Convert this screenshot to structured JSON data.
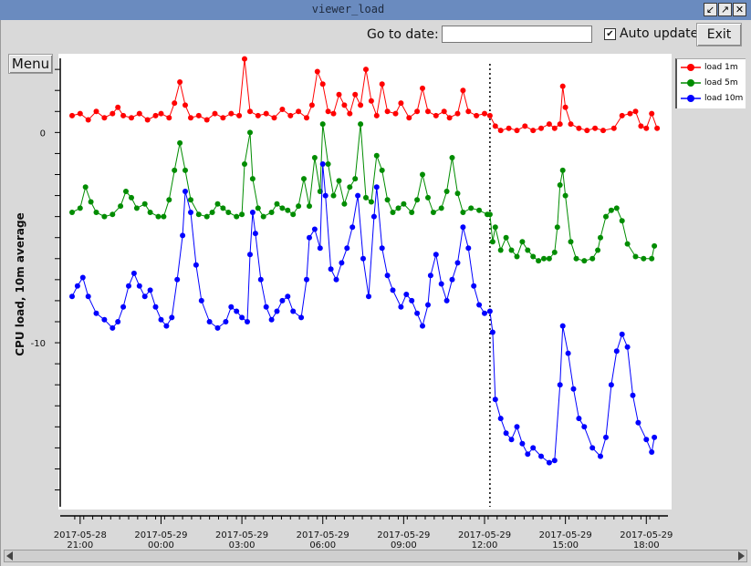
{
  "window": {
    "title": "viewer_load",
    "buttons": [
      "↙",
      "↗",
      "✕"
    ]
  },
  "toolbar": {
    "goto_label": "Go to date:",
    "goto_value": "",
    "auto_update_label": "Auto update",
    "auto_update_checked": true,
    "exit_label": "Exit",
    "menu_label": "Menu"
  },
  "colors": {
    "load_1m": "#ff0000",
    "load_5m": "#008c00",
    "load_10m": "#0000ff"
  },
  "chart_data": {
    "type": "line",
    "ylabel": "CPU load, 10m average",
    "y_ticks": [
      0,
      -10
    ],
    "ylim": [
      -17.8,
      3.7
    ],
    "x_ticks": [
      {
        "t": 21,
        "date": "2017-05-28",
        "time": "21:00"
      },
      {
        "t": 24,
        "date": "2017-05-29",
        "time": "00:00"
      },
      {
        "t": 27,
        "date": "2017-05-29",
        "time": "03:00"
      },
      {
        "t": 30,
        "date": "2017-05-29",
        "time": "06:00"
      },
      {
        "t": 33,
        "date": "2017-05-29",
        "time": "09:00"
      },
      {
        "t": 36,
        "date": "2017-05-29",
        "time": "12:00"
      },
      {
        "t": 39,
        "date": "2017-05-29",
        "time": "15:00"
      },
      {
        "t": 42,
        "date": "2017-05-29",
        "time": "18:00"
      }
    ],
    "xlim": [
      20.6,
      42.6
    ],
    "marker_line_t": 36.2,
    "legend_placement": "outside-right",
    "series": [
      {
        "name": "load 1m",
        "points": [
          [
            20.7,
            0.8
          ],
          [
            21.0,
            0.9
          ],
          [
            21.3,
            0.6
          ],
          [
            21.6,
            1.0
          ],
          [
            21.9,
            0.7
          ],
          [
            22.2,
            0.9
          ],
          [
            22.4,
            1.2
          ],
          [
            22.6,
            0.8
          ],
          [
            22.9,
            0.7
          ],
          [
            23.2,
            0.9
          ],
          [
            23.5,
            0.6
          ],
          [
            23.8,
            0.8
          ],
          [
            24.0,
            0.9
          ],
          [
            24.3,
            0.7
          ],
          [
            24.5,
            1.4
          ],
          [
            24.7,
            2.4
          ],
          [
            24.9,
            1.3
          ],
          [
            25.1,
            0.7
          ],
          [
            25.4,
            0.8
          ],
          [
            25.7,
            0.6
          ],
          [
            26.0,
            0.9
          ],
          [
            26.3,
            0.7
          ],
          [
            26.6,
            0.9
          ],
          [
            26.9,
            0.8
          ],
          [
            27.1,
            3.5
          ],
          [
            27.3,
            1.0
          ],
          [
            27.6,
            0.8
          ],
          [
            27.9,
            0.9
          ],
          [
            28.2,
            0.7
          ],
          [
            28.5,
            1.1
          ],
          [
            28.8,
            0.8
          ],
          [
            29.1,
            1.0
          ],
          [
            29.4,
            0.7
          ],
          [
            29.6,
            1.3
          ],
          [
            29.8,
            2.9
          ],
          [
            30.0,
            2.3
          ],
          [
            30.2,
            1.0
          ],
          [
            30.4,
            0.9
          ],
          [
            30.6,
            1.8
          ],
          [
            30.8,
            1.3
          ],
          [
            31.0,
            0.9
          ],
          [
            31.2,
            1.8
          ],
          [
            31.4,
            1.3
          ],
          [
            31.6,
            3.0
          ],
          [
            31.8,
            1.5
          ],
          [
            32.0,
            0.8
          ],
          [
            32.2,
            2.3
          ],
          [
            32.4,
            1.0
          ],
          [
            32.7,
            0.9
          ],
          [
            32.9,
            1.4
          ],
          [
            33.2,
            0.7
          ],
          [
            33.5,
            1.0
          ],
          [
            33.7,
            2.1
          ],
          [
            33.9,
            1.0
          ],
          [
            34.2,
            0.8
          ],
          [
            34.5,
            1.0
          ],
          [
            34.7,
            0.7
          ],
          [
            35.0,
            0.9
          ],
          [
            35.2,
            2.0
          ],
          [
            35.4,
            1.0
          ],
          [
            35.7,
            0.8
          ],
          [
            36.0,
            0.9
          ],
          [
            36.2,
            0.8
          ],
          [
            36.4,
            0.3
          ],
          [
            36.6,
            0.1
          ],
          [
            36.9,
            0.2
          ],
          [
            37.2,
            0.1
          ],
          [
            37.5,
            0.3
          ],
          [
            37.8,
            0.1
          ],
          [
            38.1,
            0.2
          ],
          [
            38.4,
            0.4
          ],
          [
            38.6,
            0.2
          ],
          [
            38.8,
            0.4
          ],
          [
            38.9,
            2.2
          ],
          [
            39.0,
            1.2
          ],
          [
            39.2,
            0.4
          ],
          [
            39.5,
            0.2
          ],
          [
            39.8,
            0.1
          ],
          [
            40.1,
            0.2
          ],
          [
            40.4,
            0.1
          ],
          [
            40.8,
            0.2
          ],
          [
            41.1,
            0.8
          ],
          [
            41.4,
            0.9
          ],
          [
            41.6,
            1.0
          ],
          [
            41.8,
            0.3
          ],
          [
            42.0,
            0.2
          ],
          [
            42.2,
            0.9
          ],
          [
            42.4,
            0.2
          ]
        ]
      },
      {
        "name": "load 5m",
        "points": [
          [
            20.7,
            -3.8
          ],
          [
            21.0,
            -3.6
          ],
          [
            21.2,
            -2.6
          ],
          [
            21.4,
            -3.3
          ],
          [
            21.6,
            -3.8
          ],
          [
            21.9,
            -4.0
          ],
          [
            22.2,
            -3.9
          ],
          [
            22.5,
            -3.5
          ],
          [
            22.7,
            -2.8
          ],
          [
            22.9,
            -3.1
          ],
          [
            23.1,
            -3.6
          ],
          [
            23.4,
            -3.4
          ],
          [
            23.6,
            -3.8
          ],
          [
            23.9,
            -4.0
          ],
          [
            24.1,
            -4.0
          ],
          [
            24.3,
            -3.2
          ],
          [
            24.5,
            -1.8
          ],
          [
            24.7,
            -0.5
          ],
          [
            24.9,
            -1.8
          ],
          [
            25.1,
            -3.2
          ],
          [
            25.4,
            -3.9
          ],
          [
            25.7,
            -4.0
          ],
          [
            25.9,
            -3.8
          ],
          [
            26.1,
            -3.4
          ],
          [
            26.3,
            -3.6
          ],
          [
            26.5,
            -3.8
          ],
          [
            26.8,
            -4.0
          ],
          [
            27.0,
            -3.9
          ],
          [
            27.1,
            -1.5
          ],
          [
            27.3,
            0.0
          ],
          [
            27.4,
            -2.2
          ],
          [
            27.6,
            -3.6
          ],
          [
            27.8,
            -4.0
          ],
          [
            28.1,
            -3.8
          ],
          [
            28.3,
            -3.4
          ],
          [
            28.5,
            -3.6
          ],
          [
            28.7,
            -3.7
          ],
          [
            28.9,
            -3.9
          ],
          [
            29.1,
            -3.5
          ],
          [
            29.3,
            -2.2
          ],
          [
            29.5,
            -3.5
          ],
          [
            29.7,
            -1.2
          ],
          [
            29.9,
            -2.8
          ],
          [
            30.0,
            0.4
          ],
          [
            30.2,
            -1.5
          ],
          [
            30.4,
            -3.0
          ],
          [
            30.6,
            -2.3
          ],
          [
            30.8,
            -3.4
          ],
          [
            31.0,
            -2.6
          ],
          [
            31.2,
            -2.2
          ],
          [
            31.4,
            0.4
          ],
          [
            31.6,
            -3.1
          ],
          [
            31.8,
            -3.3
          ],
          [
            32.0,
            -1.1
          ],
          [
            32.2,
            -1.8
          ],
          [
            32.4,
            -3.2
          ],
          [
            32.6,
            -3.8
          ],
          [
            32.8,
            -3.6
          ],
          [
            33.0,
            -3.4
          ],
          [
            33.3,
            -3.8
          ],
          [
            33.5,
            -3.2
          ],
          [
            33.7,
            -2.0
          ],
          [
            33.9,
            -3.1
          ],
          [
            34.1,
            -3.8
          ],
          [
            34.4,
            -3.6
          ],
          [
            34.6,
            -2.8
          ],
          [
            34.8,
            -1.2
          ],
          [
            35.0,
            -2.9
          ],
          [
            35.2,
            -3.8
          ],
          [
            35.5,
            -3.6
          ],
          [
            35.8,
            -3.7
          ],
          [
            36.1,
            -3.9
          ],
          [
            36.2,
            -3.9
          ],
          [
            36.3,
            -5.2
          ],
          [
            36.4,
            -4.5
          ],
          [
            36.6,
            -5.6
          ],
          [
            36.8,
            -5.0
          ],
          [
            37.0,
            -5.6
          ],
          [
            37.2,
            -5.9
          ],
          [
            37.4,
            -5.2
          ],
          [
            37.6,
            -5.6
          ],
          [
            37.8,
            -5.9
          ],
          [
            38.0,
            -6.1
          ],
          [
            38.2,
            -6.0
          ],
          [
            38.4,
            -6.0
          ],
          [
            38.6,
            -5.7
          ],
          [
            38.7,
            -4.5
          ],
          [
            38.8,
            -2.5
          ],
          [
            38.9,
            -1.8
          ],
          [
            39.0,
            -3.0
          ],
          [
            39.2,
            -5.2
          ],
          [
            39.4,
            -6.0
          ],
          [
            39.7,
            -6.1
          ],
          [
            40.0,
            -6.0
          ],
          [
            40.2,
            -5.6
          ],
          [
            40.3,
            -5.0
          ],
          [
            40.5,
            -4.0
          ],
          [
            40.7,
            -3.7
          ],
          [
            40.9,
            -3.6
          ],
          [
            41.1,
            -4.2
          ],
          [
            41.3,
            -5.3
          ],
          [
            41.6,
            -5.9
          ],
          [
            41.9,
            -6.0
          ],
          [
            42.2,
            -6.0
          ],
          [
            42.3,
            -5.4
          ]
        ]
      },
      {
        "name": "load 10m",
        "points": [
          [
            20.7,
            -7.8
          ],
          [
            20.9,
            -7.3
          ],
          [
            21.1,
            -6.9
          ],
          [
            21.3,
            -7.8
          ],
          [
            21.6,
            -8.6
          ],
          [
            21.9,
            -8.9
          ],
          [
            22.2,
            -9.3
          ],
          [
            22.4,
            -9.0
          ],
          [
            22.6,
            -8.3
          ],
          [
            22.8,
            -7.3
          ],
          [
            23.0,
            -6.7
          ],
          [
            23.2,
            -7.3
          ],
          [
            23.4,
            -7.8
          ],
          [
            23.6,
            -7.5
          ],
          [
            23.8,
            -8.3
          ],
          [
            24.0,
            -8.9
          ],
          [
            24.2,
            -9.2
          ],
          [
            24.4,
            -8.8
          ],
          [
            24.6,
            -7.0
          ],
          [
            24.8,
            -4.9
          ],
          [
            24.9,
            -2.8
          ],
          [
            25.1,
            -3.8
          ],
          [
            25.3,
            -6.3
          ],
          [
            25.5,
            -8.0
          ],
          [
            25.8,
            -9.0
          ],
          [
            26.1,
            -9.3
          ],
          [
            26.4,
            -9.0
          ],
          [
            26.6,
            -8.3
          ],
          [
            26.8,
            -8.5
          ],
          [
            27.0,
            -8.8
          ],
          [
            27.2,
            -9.0
          ],
          [
            27.3,
            -5.8
          ],
          [
            27.4,
            -3.8
          ],
          [
            27.5,
            -4.8
          ],
          [
            27.7,
            -7.0
          ],
          [
            27.9,
            -8.3
          ],
          [
            28.1,
            -8.9
          ],
          [
            28.3,
            -8.5
          ],
          [
            28.5,
            -8.0
          ],
          [
            28.7,
            -7.8
          ],
          [
            28.9,
            -8.5
          ],
          [
            29.2,
            -8.8
          ],
          [
            29.4,
            -7.0
          ],
          [
            29.5,
            -5.0
          ],
          [
            29.7,
            -4.6
          ],
          [
            29.9,
            -5.5
          ],
          [
            30.0,
            -1.5
          ],
          [
            30.1,
            -3.0
          ],
          [
            30.3,
            -6.5
          ],
          [
            30.5,
            -7.0
          ],
          [
            30.7,
            -6.2
          ],
          [
            30.9,
            -5.5
          ],
          [
            31.1,
            -4.5
          ],
          [
            31.3,
            -3.0
          ],
          [
            31.5,
            -6.0
          ],
          [
            31.7,
            -7.8
          ],
          [
            31.9,
            -4.0
          ],
          [
            32.0,
            -2.6
          ],
          [
            32.2,
            -5.5
          ],
          [
            32.4,
            -6.8
          ],
          [
            32.6,
            -7.5
          ],
          [
            32.9,
            -8.3
          ],
          [
            33.1,
            -7.7
          ],
          [
            33.3,
            -8.0
          ],
          [
            33.5,
            -8.6
          ],
          [
            33.7,
            -9.2
          ],
          [
            33.9,
            -8.2
          ],
          [
            34.0,
            -6.8
          ],
          [
            34.2,
            -5.8
          ],
          [
            34.4,
            -7.2
          ],
          [
            34.6,
            -8.0
          ],
          [
            34.8,
            -7.0
          ],
          [
            35.0,
            -6.2
          ],
          [
            35.2,
            -4.5
          ],
          [
            35.4,
            -5.5
          ],
          [
            35.6,
            -7.3
          ],
          [
            35.8,
            -8.2
          ],
          [
            36.0,
            -8.6
          ],
          [
            36.2,
            -8.5
          ],
          [
            36.3,
            -9.5
          ],
          [
            36.4,
            -12.7
          ],
          [
            36.6,
            -13.6
          ],
          [
            36.8,
            -14.3
          ],
          [
            37.0,
            -14.6
          ],
          [
            37.2,
            -14.0
          ],
          [
            37.4,
            -14.8
          ],
          [
            37.6,
            -15.3
          ],
          [
            37.8,
            -15.0
          ],
          [
            38.1,
            -15.4
          ],
          [
            38.4,
            -15.7
          ],
          [
            38.6,
            -15.6
          ],
          [
            38.8,
            -12.0
          ],
          [
            38.9,
            -9.2
          ],
          [
            39.1,
            -10.5
          ],
          [
            39.3,
            -12.2
          ],
          [
            39.5,
            -13.6
          ],
          [
            39.7,
            -14.0
          ],
          [
            40.0,
            -15.0
          ],
          [
            40.3,
            -15.4
          ],
          [
            40.5,
            -14.5
          ],
          [
            40.7,
            -12.0
          ],
          [
            40.9,
            -10.4
          ],
          [
            41.1,
            -9.6
          ],
          [
            41.3,
            -10.2
          ],
          [
            41.5,
            -12.5
          ],
          [
            41.7,
            -13.8
          ],
          [
            42.0,
            -14.6
          ],
          [
            42.2,
            -15.2
          ],
          [
            42.3,
            -14.5
          ]
        ]
      }
    ]
  }
}
